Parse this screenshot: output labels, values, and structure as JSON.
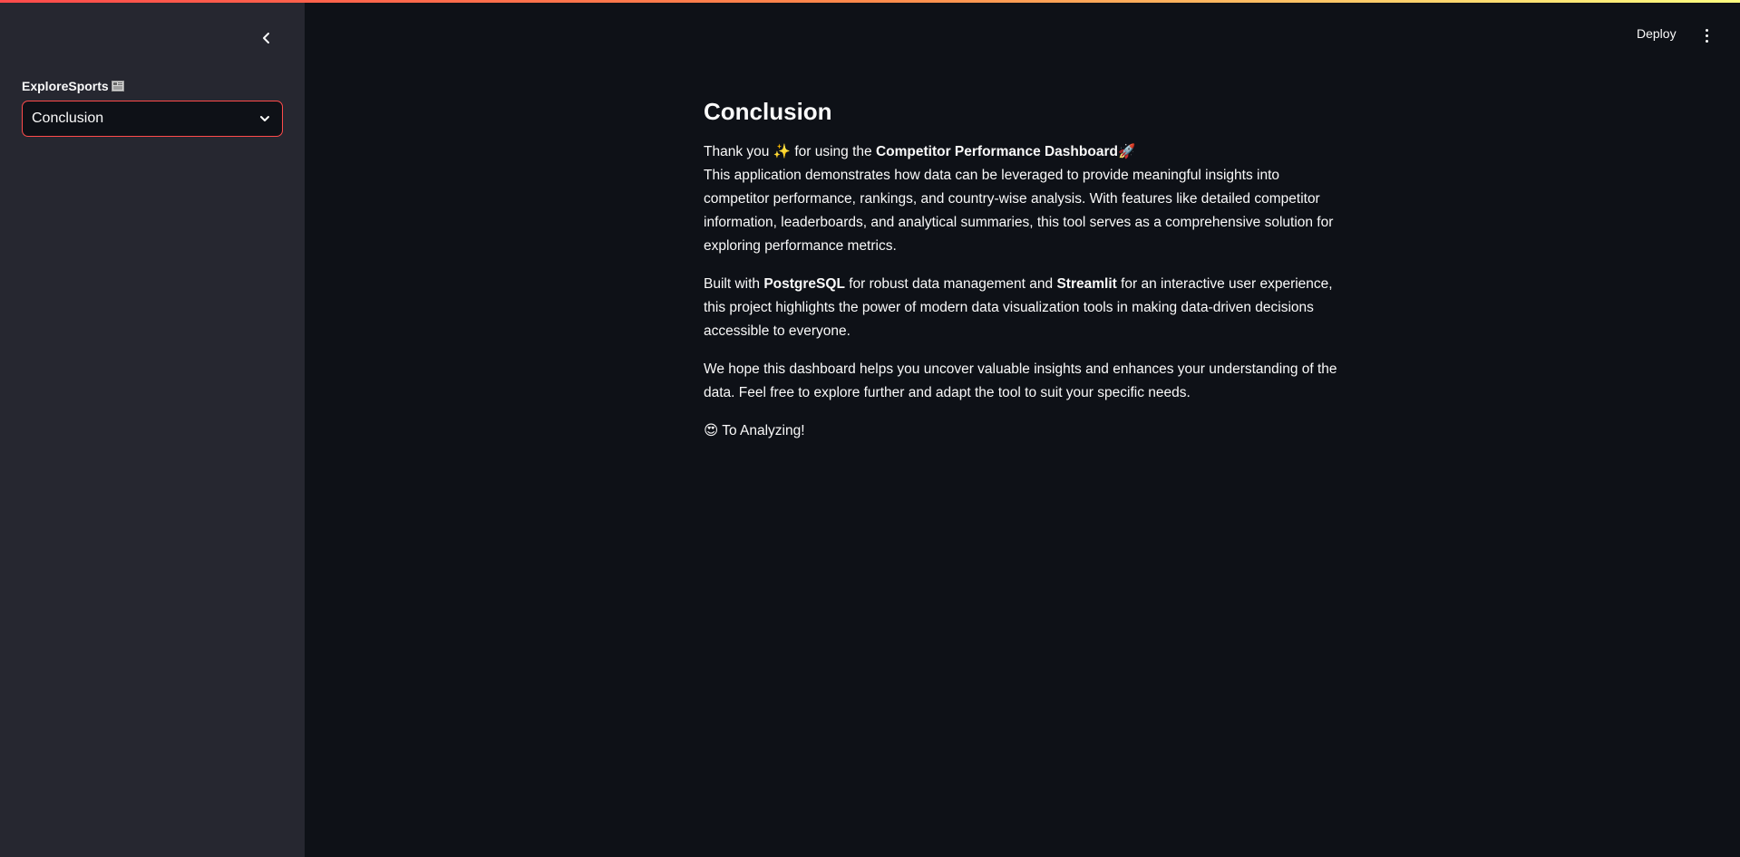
{
  "sidebar": {
    "label": "ExploreSports",
    "label_icon": "newspaper-icon",
    "select_value": "Conclusion"
  },
  "header": {
    "deploy_label": "Deploy"
  },
  "main": {
    "title": "Conclusion",
    "p1": {
      "a": "Thank you",
      "sparkle": "✨",
      "b": "for using the",
      "bold": "Competitor Performance Dashboard",
      "rocket": "🚀",
      "c": "This application demonstrates how data can be leveraged to provide meaningful insights into competitor performance, rankings, and country-wise analysis. With features like detailed competitor information, leaderboards, and analytical summaries, this tool serves as a comprehensive solution for exploring performance metrics."
    },
    "p2": {
      "a": "Built with",
      "bold1": "PostgreSQL",
      "b": "for robust data management and",
      "bold2": "Streamlit",
      "c": "for an interactive user experience, this project highlights the power of modern data visualization tools in making data-driven decisions accessible to everyone."
    },
    "p3": "We hope this dashboard helps you uncover valuable insights and enhances your understanding of the data. Feel free to explore further and adapt the tool to suit your specific needs.",
    "p4": {
      "emoji": "😍",
      "text": "To Analyzing!"
    }
  },
  "colors": {
    "accent": "#ff4b4b",
    "sidebar_bg": "#262730",
    "main_bg": "#0e1117"
  }
}
